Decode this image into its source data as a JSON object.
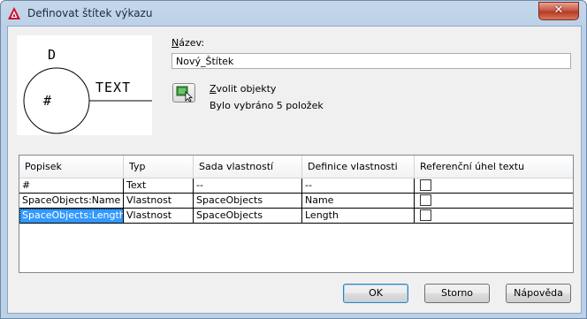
{
  "window": {
    "title": "Definovat štítek výkazu",
    "close_glyph": "✕"
  },
  "preview": {
    "top_letter": "D",
    "center_symbol": "#",
    "side_text": "TEXT"
  },
  "name": {
    "label_first": "N",
    "label_rest": "ázev:",
    "value": "Nový_Štítek"
  },
  "select_objects": {
    "label_first": "Z",
    "label_rest": "volit objekty",
    "status": "Bylo vybráno 5 položek"
  },
  "table": {
    "headers": [
      "Popisek",
      "Typ",
      "Sada vlastností",
      "Definice vlastnosti",
      "Referenční úhel textu"
    ],
    "rows": [
      {
        "label": "#",
        "type": "Text",
        "set": "--",
        "definition": "--",
        "ref_angle": false
      },
      {
        "label": "SpaceObjects:Name",
        "type": "Vlastnost",
        "set": "SpaceObjects",
        "definition": "Name",
        "ref_angle": false
      },
      {
        "label": "SpaceObjects:Length",
        "type": "Vlastnost",
        "set": "SpaceObjects",
        "definition": "Length",
        "ref_angle": false
      }
    ]
  },
  "buttons": {
    "ok": "OK",
    "cancel": "Storno",
    "help": "Nápověda"
  }
}
